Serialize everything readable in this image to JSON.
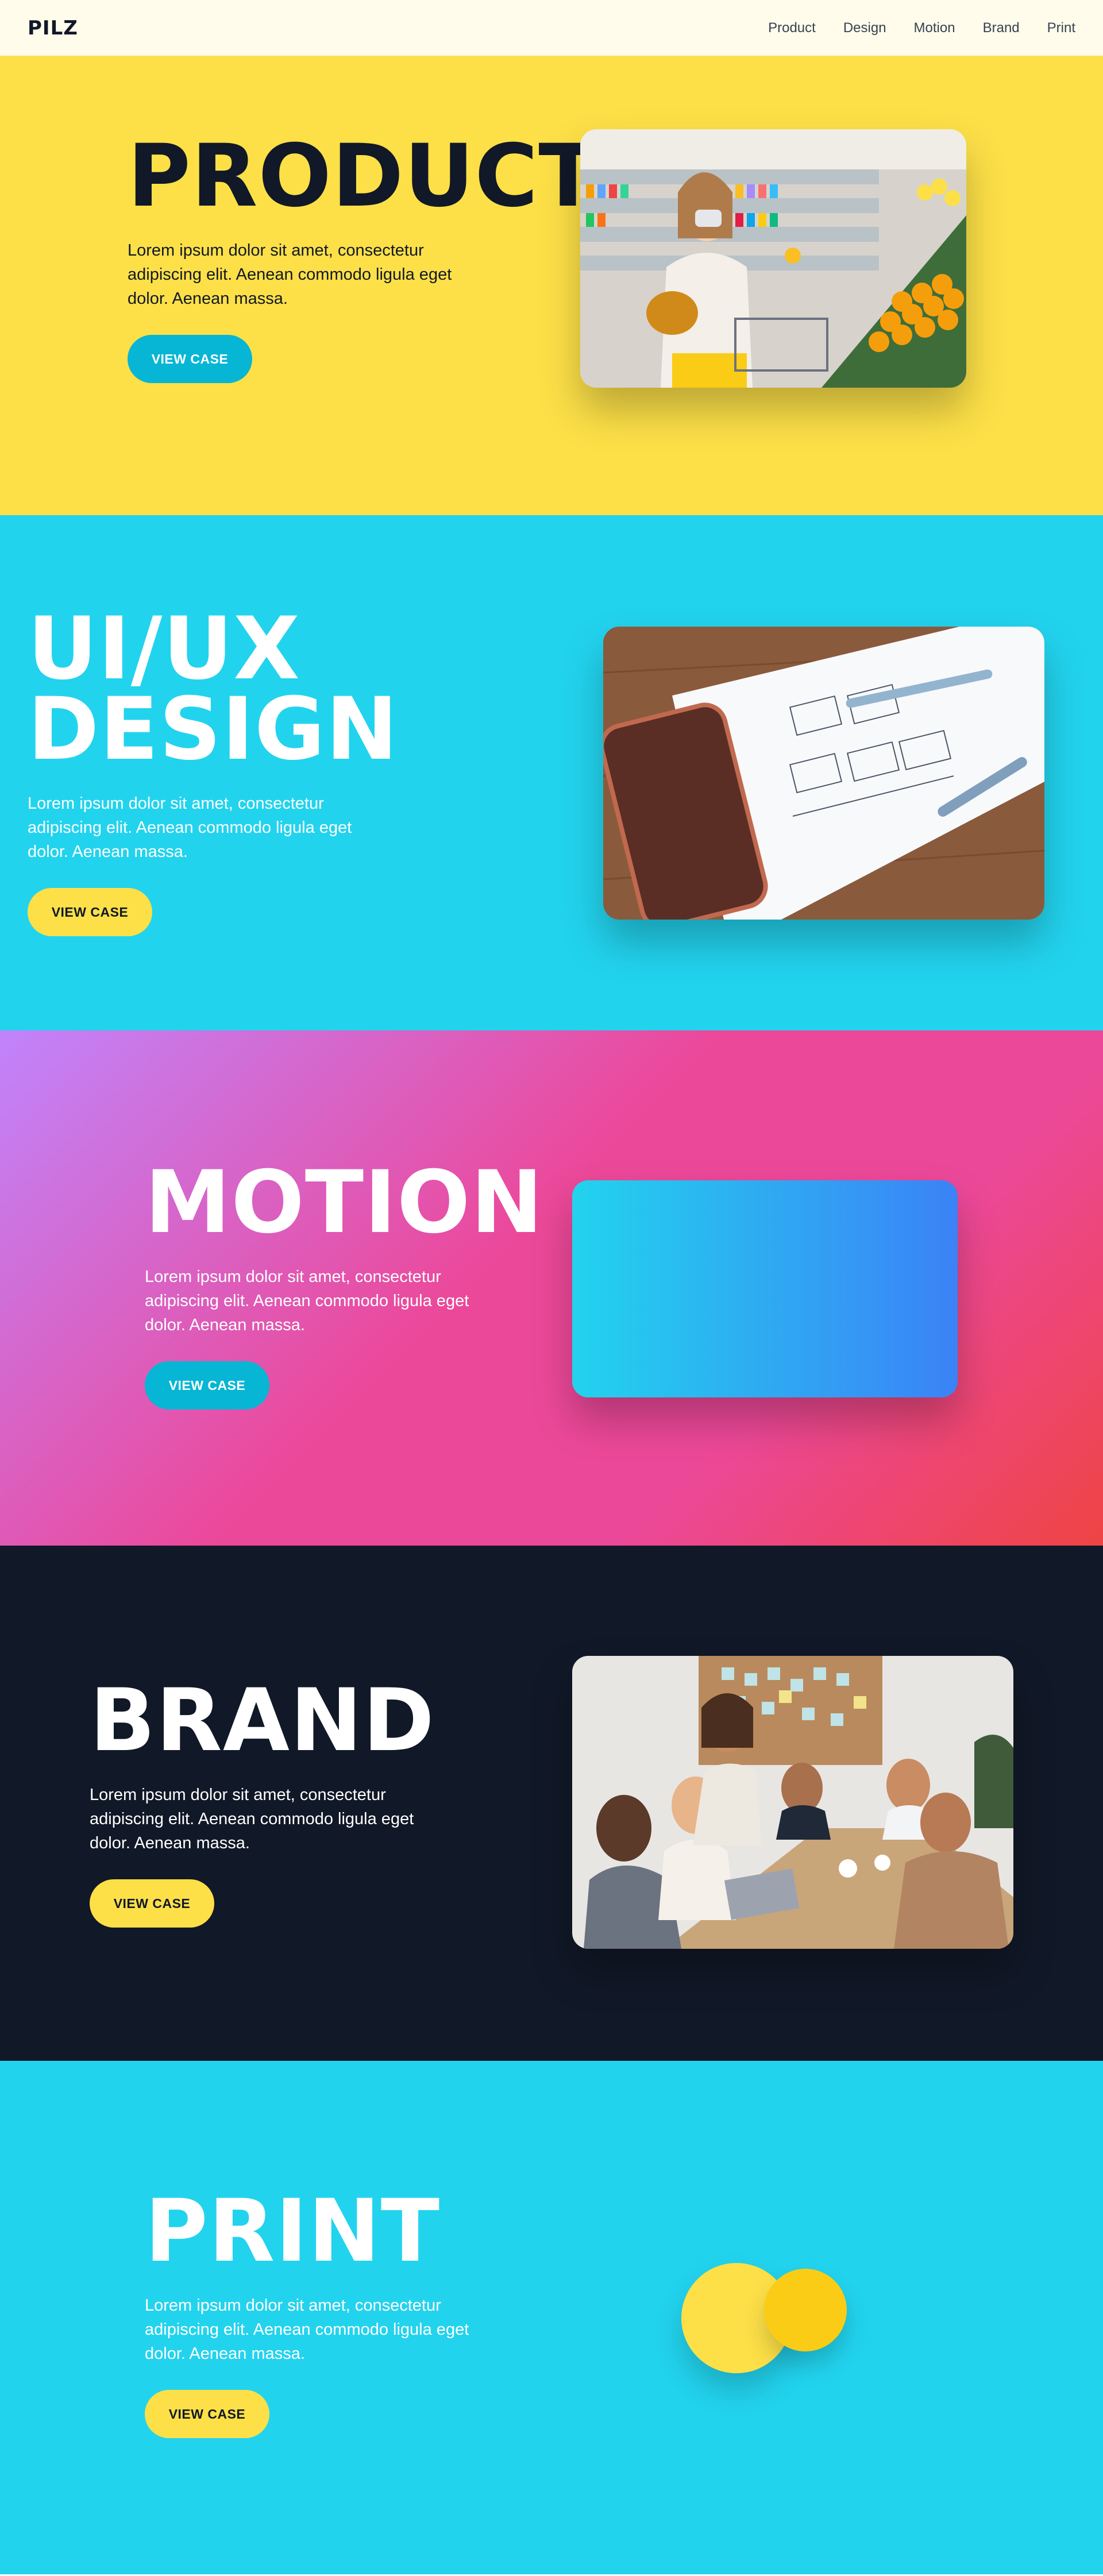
{
  "nav": {
    "logo": "PILZ",
    "links": [
      "Product",
      "Design",
      "Motion",
      "Brand",
      "Print"
    ]
  },
  "sections": {
    "product": {
      "heading": "PRODUCT",
      "description": "Lorem ipsum dolor sit amet, consectetur adipiscing elit. Aenean commodo ligula eget dolor. Aenean massa.",
      "button": "VIEW CASE"
    },
    "design": {
      "heading_line1": "UI/UX",
      "heading_line2": "DESIGN",
      "description": "Lorem ipsum dolor sit amet, consectetur adipiscing elit. Aenean commodo ligula eget dolor. Aenean massa.",
      "button": "VIEW CASE"
    },
    "motion": {
      "heading": "MOTION",
      "description": "Lorem ipsum dolor sit amet, consectetur adipiscing elit. Aenean commodo ligula eget dolor. Aenean massa.",
      "button": "VIEW CASE"
    },
    "brand": {
      "heading": "BRAND",
      "description": "Lorem ipsum dolor sit amet, consectetur adipiscing elit. Aenean commodo ligula eget dolor. Aenean massa.",
      "button": "VIEW CASE"
    },
    "print": {
      "heading": "PRINT",
      "description": "Lorem ipsum dolor sit amet, consectetur adipiscing elit. Aenean commodo ligula eget dolor. Aenean massa.",
      "button": "VIEW CASE"
    }
  },
  "colors": {
    "yellow": "#fde047",
    "cyan": "#22d3ee",
    "button_blue": "#06b6d4",
    "navy": "#111827",
    "nav_bg": "#fffceb"
  }
}
